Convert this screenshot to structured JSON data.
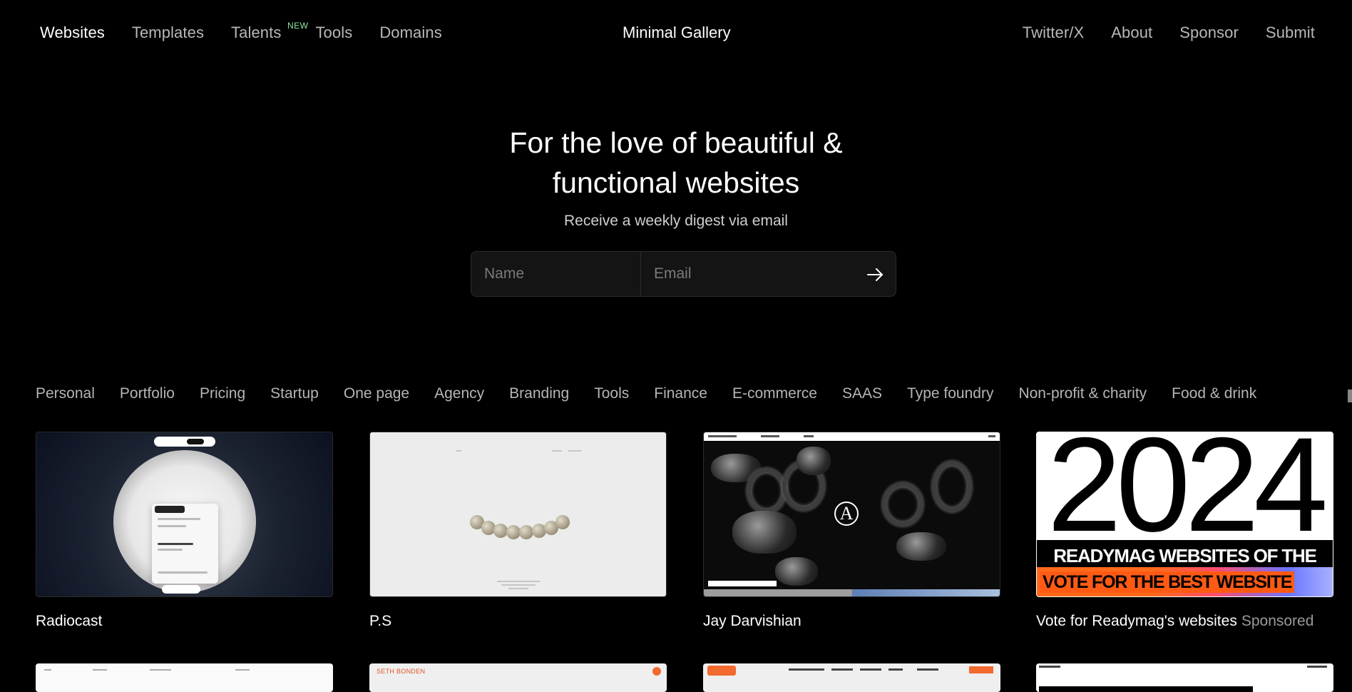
{
  "nav": {
    "left": [
      {
        "label": "Websites",
        "active": true
      },
      {
        "label": "Templates",
        "active": false
      },
      {
        "label": "Talents",
        "badge": "NEW",
        "active": false
      },
      {
        "label": "Tools",
        "active": false
      },
      {
        "label": "Domains",
        "active": false
      }
    ],
    "brand": "Minimal Gallery",
    "right": [
      "Twitter/X",
      "About",
      "Sponsor",
      "Submit"
    ]
  },
  "hero": {
    "title_line1": "For the love of beautiful &",
    "title_line2": "functional websites",
    "subtitle": "Receive a weekly digest via email"
  },
  "subscribe": {
    "name_placeholder": "Name",
    "email_placeholder": "Email",
    "submit_icon": "arrow-right-icon"
  },
  "categories": [
    "Personal",
    "Portfolio",
    "Pricing",
    "Startup",
    "One page",
    "Agency",
    "Branding",
    "Tools",
    "Finance",
    "E-commerce",
    "SAAS",
    "Type foundry",
    "Non-profit & charity",
    "Food & drink"
  ],
  "cards": [
    {
      "title": "Radiocast"
    },
    {
      "title": "P.S"
    },
    {
      "title": "Jay Darvishian"
    },
    {
      "title": "Vote for Readymag's websites",
      "tag": "Sponsored",
      "thumb_year": "2024",
      "thumb_heading": "READYMAG WEBSITES OF THE YEAR",
      "thumb_cta": "VOTE FOR THE BEST WEBSITE"
    }
  ],
  "row2": {
    "card2_label": "SETH BONDEN"
  },
  "colors": {
    "background": "#000000",
    "text": "#ffffff",
    "muted": "#b8b8b8",
    "badge": "#8fe6a2",
    "accent_orange": "#ff5a14"
  }
}
